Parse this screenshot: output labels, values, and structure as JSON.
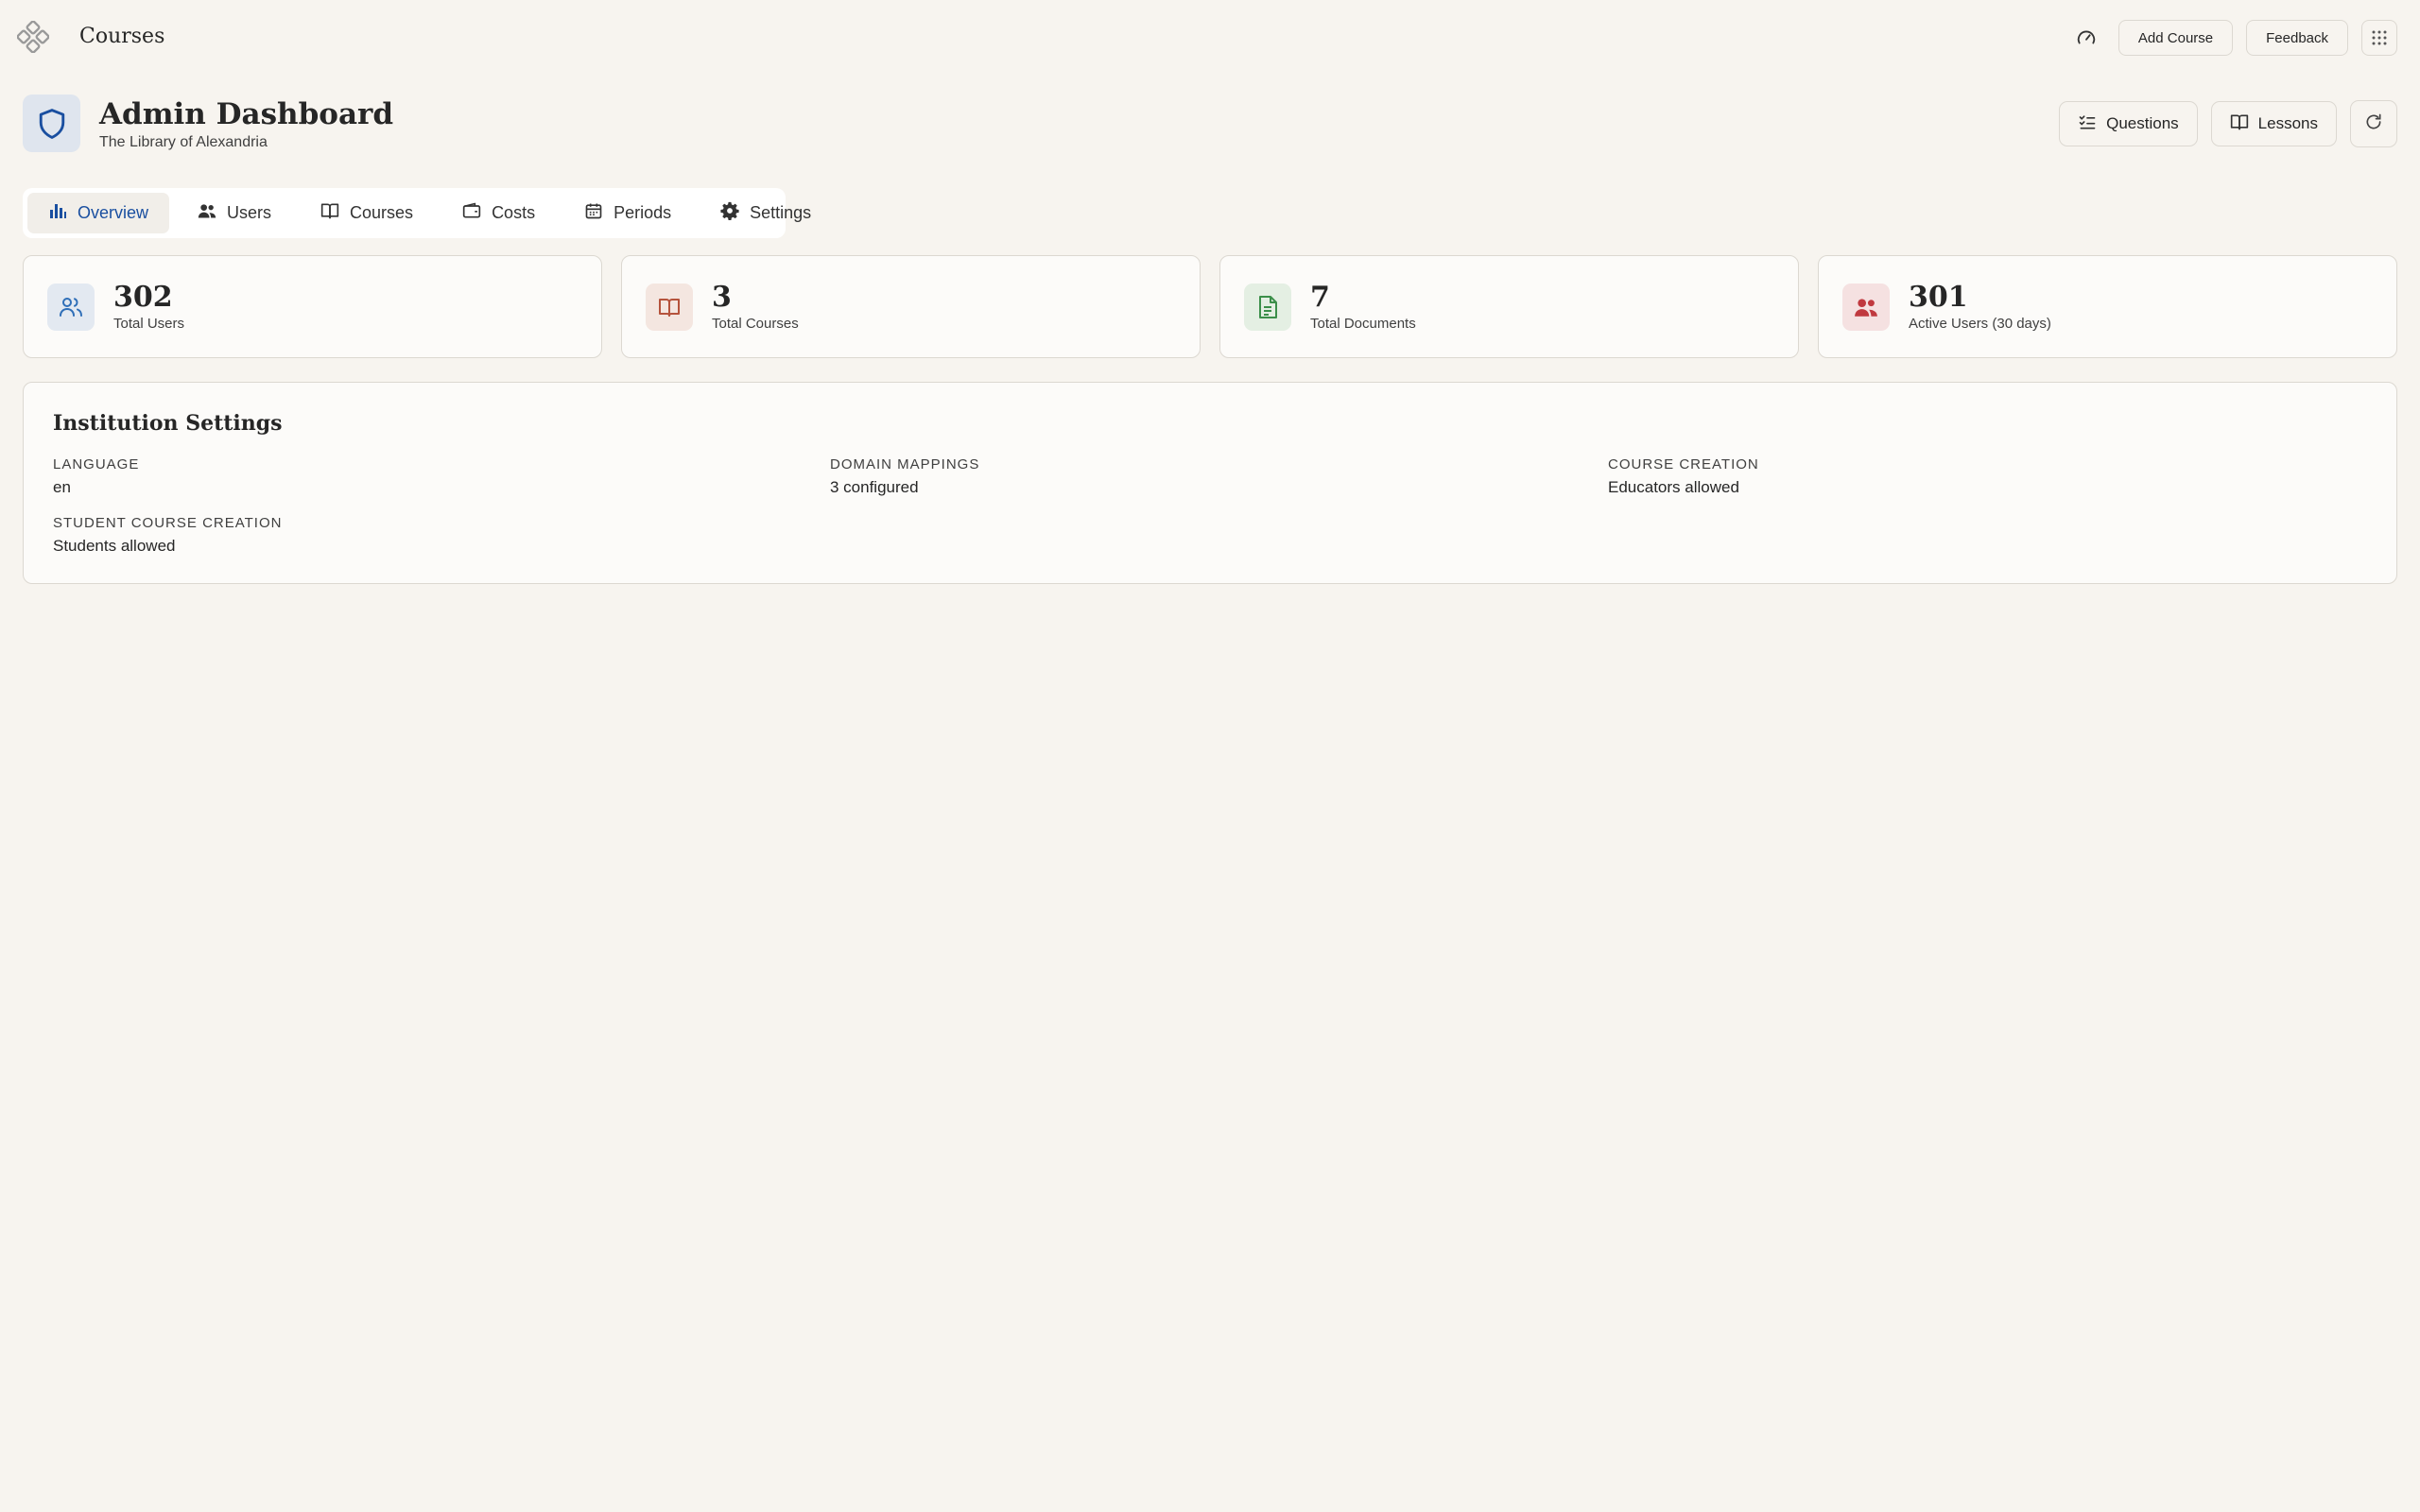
{
  "app": {
    "title": "Courses"
  },
  "topbar": {
    "add_course_label": "Add Course",
    "feedback_label": "Feedback"
  },
  "header": {
    "title": "Admin Dashboard",
    "subtitle": "The Library of Alexandria",
    "questions_label": "Questions",
    "lessons_label": "Lessons"
  },
  "tabs": [
    {
      "label": "Overview",
      "icon": "bar-chart-icon",
      "active": true
    },
    {
      "label": "Users",
      "icon": "users-icon",
      "active": false
    },
    {
      "label": "Courses",
      "icon": "book-icon",
      "active": false
    },
    {
      "label": "Costs",
      "icon": "wallet-icon",
      "active": false
    },
    {
      "label": "Periods",
      "icon": "calendar-icon",
      "active": false
    },
    {
      "label": "Settings",
      "icon": "gear-icon",
      "active": false
    }
  ],
  "stats": [
    {
      "value": "302",
      "label": "Total Users",
      "icon": "users-outline-icon",
      "color": "#2f6fb8",
      "bg": "#e3e9f1"
    },
    {
      "value": "3",
      "label": "Total Courses",
      "icon": "book-open-icon",
      "color": "#b5533c",
      "bg": "#f4e6e0"
    },
    {
      "value": "7",
      "label": "Total Documents",
      "icon": "document-icon",
      "color": "#3c8f4a",
      "bg": "#e4efe3"
    },
    {
      "value": "301",
      "label": "Active Users (30 days)",
      "icon": "users-filled-icon",
      "color": "#c0393f",
      "bg": "#f5e1e1"
    }
  ],
  "settings": {
    "title": "Institution Settings",
    "items": [
      {
        "label": "LANGUAGE",
        "value": "en"
      },
      {
        "label": "DOMAIN MAPPINGS",
        "value": "3 configured"
      },
      {
        "label": "COURSE CREATION",
        "value": "Educators allowed"
      },
      {
        "label": "STUDENT COURSE CREATION",
        "value": "Students allowed"
      }
    ]
  },
  "colors": {
    "background": "#f7f4ef",
    "accent": "#1a4fa0"
  }
}
